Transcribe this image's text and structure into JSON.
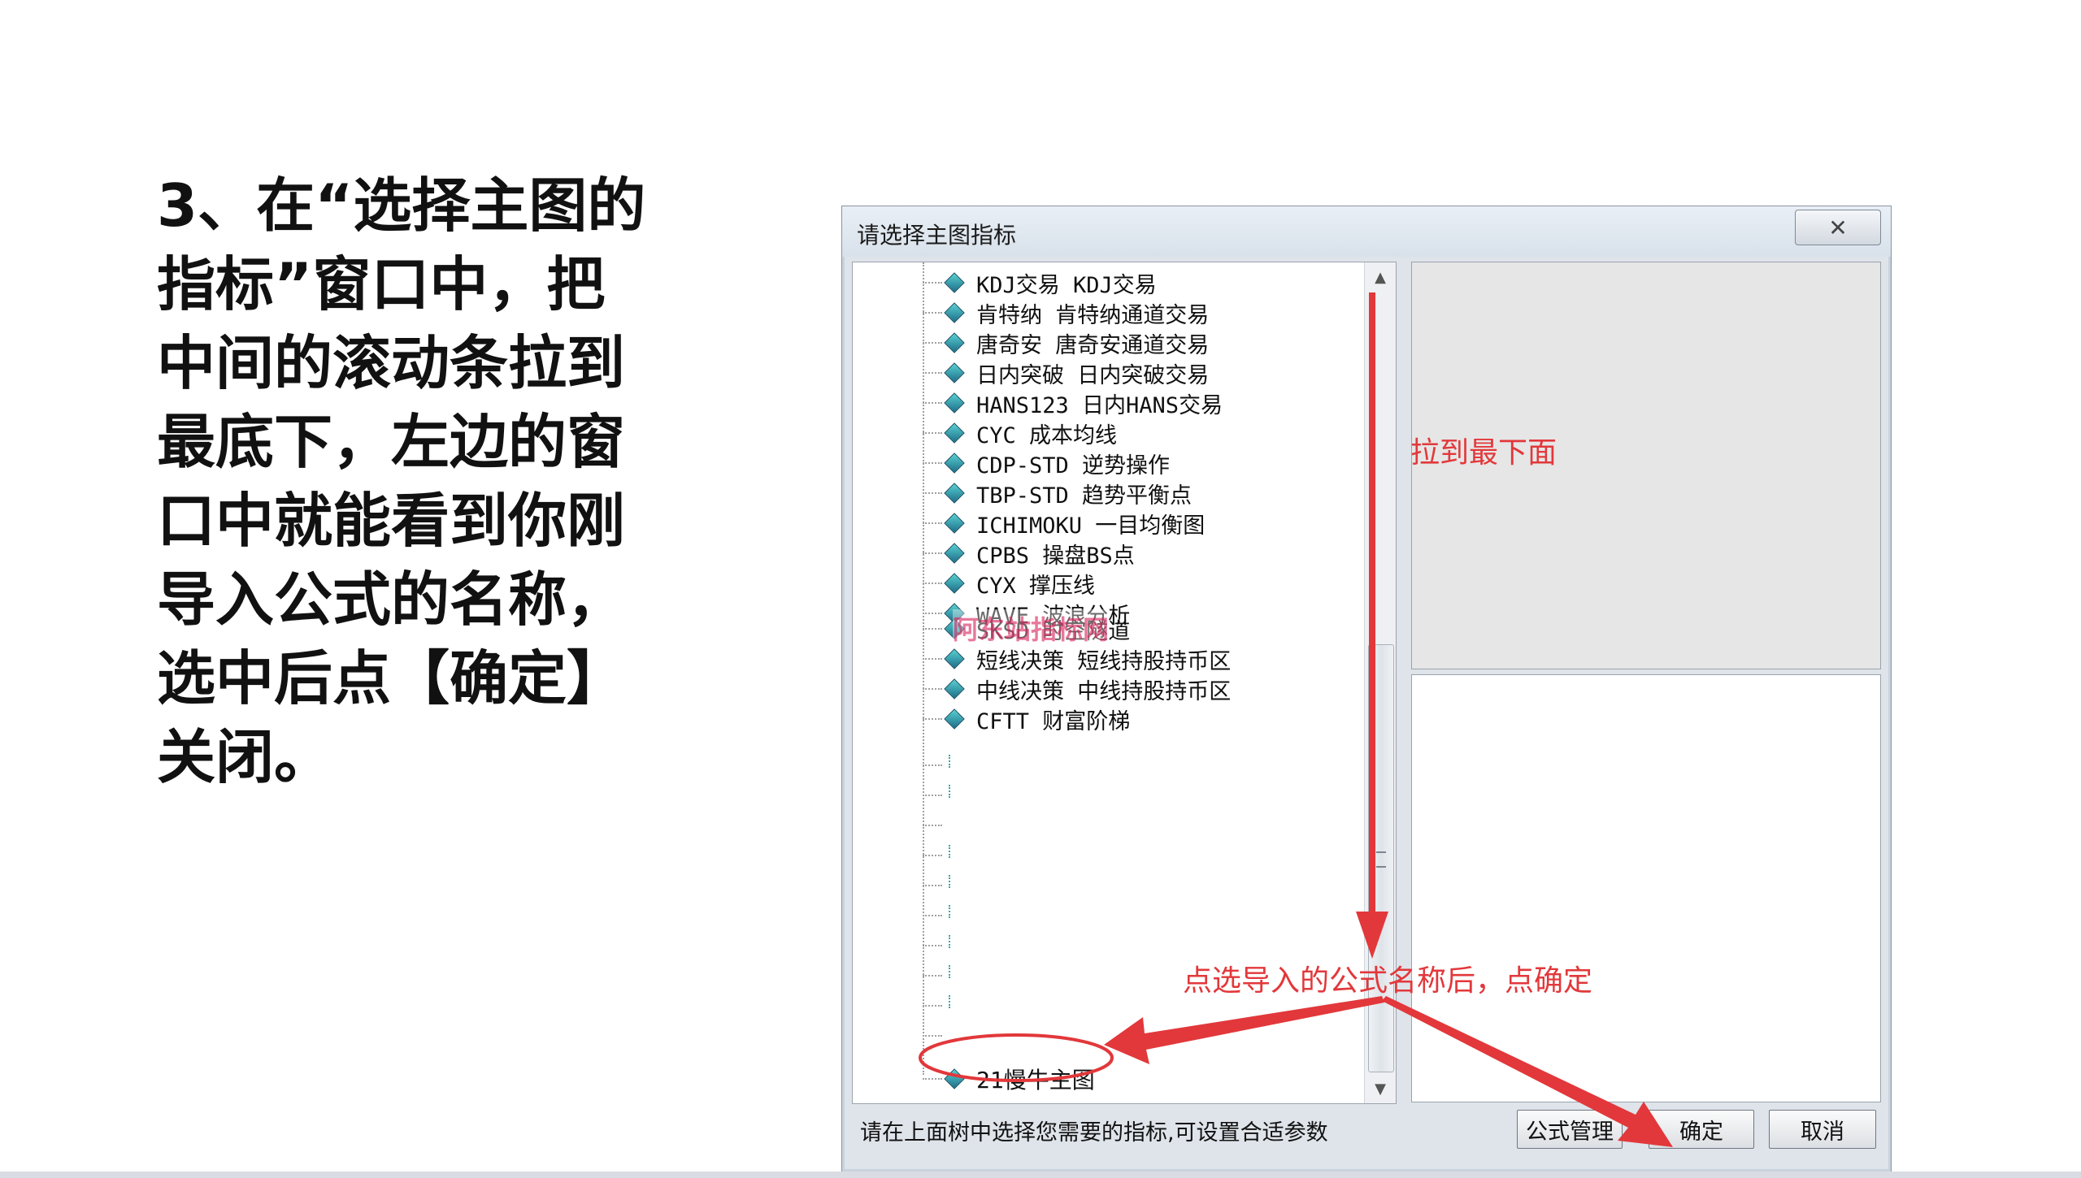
{
  "instruction": {
    "lines": [
      "3、在“选择主图的",
      "指标”窗口中，把",
      "中间的滚动条拉到",
      "最底下，左边的窗",
      "口中就能看到你刚",
      "导入公式的名称，",
      "选中后点【确定】",
      "关闭。"
    ]
  },
  "dialog": {
    "title": "请选择主图指标",
    "close_icon": "✕",
    "tree_items": [
      "KDJ交易 KDJ交易",
      "肯特纳 肯特纳通道交易",
      "唐奇安 唐奇安通道交易",
      "日内突破 日内突破交易",
      "HANS123 日内HANS交易",
      "CYC 成本均线",
      "CDP-STD 逆势操作",
      "TBP-STD 趋势平衡点",
      "ICHIMOKU 一目均衡图",
      "CPBS 操盘BS点",
      "CYX 撑压线",
      "WAVE 波浪分析",
      "SKSD 时空隧道",
      "短线决策 短线持股持币区",
      "中线决策 中线持股持币区",
      "CFTT 财富阶梯"
    ],
    "selected_item": "21慢牛主图",
    "status_text": "请在上面树中选择您需要的指标,可设置合适参数",
    "buttons": {
      "formula_manage": "公式管理",
      "confirm": "确定",
      "cancel": "取消"
    }
  },
  "watermark": "阿东站指标网",
  "annotations": {
    "drag_bottom": "拉到最下面",
    "select_confirm": "点选导入的公式名称后，点确定"
  },
  "colors": {
    "annotation_red": "#e2383b",
    "watermark_pink": "#e04a7a"
  }
}
